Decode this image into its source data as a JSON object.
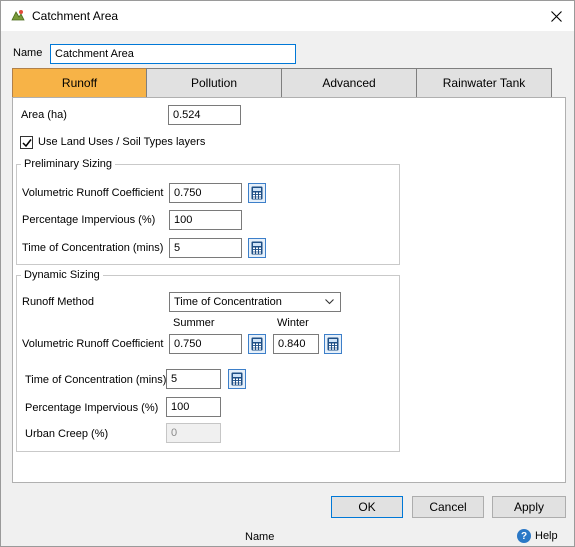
{
  "window": {
    "title": "Catchment Area"
  },
  "name": {
    "label": "Name",
    "value": "Catchment Area"
  },
  "tabs": [
    {
      "label": "Runoff",
      "active": true
    },
    {
      "label": "Pollution",
      "active": false
    },
    {
      "label": "Advanced",
      "active": false
    },
    {
      "label": "Rainwater Tank",
      "active": false
    }
  ],
  "runoff": {
    "area_label": "Area (ha)",
    "area_value": "0.524",
    "use_layers_label": "Use Land Uses / Soil Types layers",
    "use_layers_checked": true,
    "preliminary": {
      "title": "Preliminary Sizing",
      "vrc_label": "Volumetric Runoff Coefficient",
      "vrc_value": "0.750",
      "pimp_label": "Percentage Impervious (%)",
      "pimp_value": "100",
      "toc_label": "Time of Concentration (mins)",
      "toc_value": "5"
    },
    "dynamic": {
      "title": "Dynamic Sizing",
      "method_label": "Runoff Method",
      "method_value": "Time of Concentration",
      "summer_label": "Summer",
      "winter_label": "Winter",
      "vrc_label": "Volumetric Runoff Coefficient",
      "vrc_summer": "0.750",
      "vrc_winter": "0.840",
      "toc_label": "Time of Concentration (mins)",
      "toc_value": "5",
      "pimp_label": "Percentage Impervious (%)",
      "pimp_value": "100",
      "creep_label": "Urban Creep (%)",
      "creep_value": "0"
    }
  },
  "buttons": {
    "ok": "OK",
    "cancel": "Cancel",
    "apply": "Apply"
  },
  "status": {
    "text": "Name",
    "help": "Help"
  },
  "colors": {
    "active_tab": "#f7b347",
    "accent": "#0078d7"
  }
}
